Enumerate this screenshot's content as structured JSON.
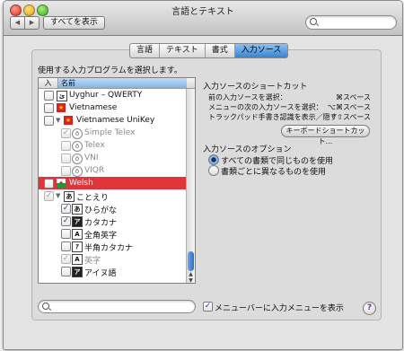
{
  "window": {
    "title": "言語とテキスト",
    "show_all": "すべてを表示",
    "search_placeholder": ""
  },
  "tabs": [
    {
      "label": "言語",
      "active": false
    },
    {
      "label": "テキスト",
      "active": false
    },
    {
      "label": "書式",
      "active": false
    },
    {
      "label": "入力ソース",
      "active": true
    }
  ],
  "left": {
    "prompt": "使用する入力プログラムを選択します。",
    "col_in": "入",
    "col_name": "名前",
    "rows": [
      {
        "text": "Uyghur – QWERTY",
        "checked": false,
        "icon": "uyghur-icon",
        "glyph": "ئ"
      },
      {
        "text": "Vietnamese",
        "checked": false,
        "icon": "vietnam-flag-icon",
        "glyph": "★"
      },
      {
        "text": "Vietnamese UniKey",
        "checked": false,
        "icon": "vietnam-flag-icon",
        "glyph": "★",
        "expanded": true
      },
      {
        "text": "Simple Telex",
        "checked": true,
        "dim": true,
        "icon": "input-method-icon",
        "glyph": "ō"
      },
      {
        "text": "Telex",
        "checked": false,
        "dim": true,
        "icon": "input-method-icon",
        "glyph": "ō"
      },
      {
        "text": "VNI",
        "checked": false,
        "dim": true,
        "icon": "input-method-icon",
        "glyph": "ō"
      },
      {
        "text": "VIQR",
        "checked": false,
        "dim": true,
        "icon": "input-method-icon",
        "glyph": "ō"
      },
      {
        "text": "Welsh",
        "checked": false,
        "selected": true,
        "icon": "wales-flag-icon",
        "glyph": "✦"
      },
      {
        "text": "ことえり",
        "checked": true,
        "dim_check": true,
        "icon": "kotoeri-icon",
        "glyph": "あ",
        "expanded": true
      },
      {
        "text": "ひらがな",
        "checked": true,
        "icon": "hiragana-icon",
        "glyph": "あ"
      },
      {
        "text": "カタカナ",
        "checked": true,
        "icon": "katakana-icon",
        "glyph": "ア"
      },
      {
        "text": "全角英字",
        "checked": false,
        "icon": "fullwidth-alpha-icon",
        "glyph": "A"
      },
      {
        "text": "半角カタカナ",
        "checked": false,
        "icon": "halfwidth-katakana-icon",
        "glyph": "ｱ"
      },
      {
        "text": "英字",
        "checked": true,
        "dim": true,
        "icon": "romaji-icon",
        "glyph": "A"
      },
      {
        "text": "アイヌ語",
        "checked": false,
        "icon": "ainu-icon",
        "glyph": "ア"
      }
    ]
  },
  "shortcuts": {
    "title": "入力ソースのショートカット",
    "items": [
      {
        "label": "前の入力ソースを選択：",
        "key": "⌘スペース"
      },
      {
        "label": "メニューの次の入力ソースを選択：",
        "key": "⌥⌘スペース"
      },
      {
        "label": "トラックパッド手書き認識を表示／隠す",
        "key": "^⇧スペース"
      }
    ],
    "button": "キーボードショートカット..."
  },
  "options": {
    "title": "入力ソースのオプション",
    "choices": [
      {
        "label": "すべての書類で同じものを使用",
        "selected": true
      },
      {
        "label": "書類ごとに異なるものを使用",
        "selected": false
      }
    ]
  },
  "bottom": {
    "menu_checkbox": "メニューバーに入力メニューを表示",
    "menu_checked": true,
    "search_placeholder": ""
  },
  "help_glyph": "?",
  "colors": {
    "selected_row": "#e0333a",
    "accent_blue": "#3a83d1"
  }
}
